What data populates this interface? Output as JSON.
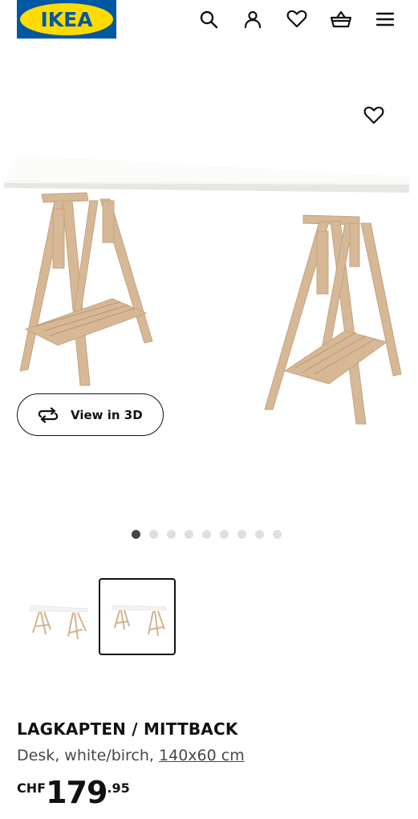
{
  "header": {
    "logo_text": "IKEA",
    "icons": {
      "search": "search-icon",
      "account": "user-icon",
      "favourites": "heart-icon",
      "cart": "basket-icon",
      "menu": "hamburger-menu-icon"
    }
  },
  "gallery": {
    "view_3d_label": "View in 3D",
    "dots_total": 9,
    "active_dot": 1,
    "selected_thumbnail": 2
  },
  "product": {
    "name": "LAGKAPTEN / MITTBACK",
    "description": "Desk, white/birch,",
    "size": "140x60 cm",
    "price": {
      "currency": "CHF",
      "integer": "179",
      "decimal": ".95"
    }
  },
  "colors": {
    "brand_blue": "#0058a3",
    "brand_yellow": "#ffdb00"
  }
}
